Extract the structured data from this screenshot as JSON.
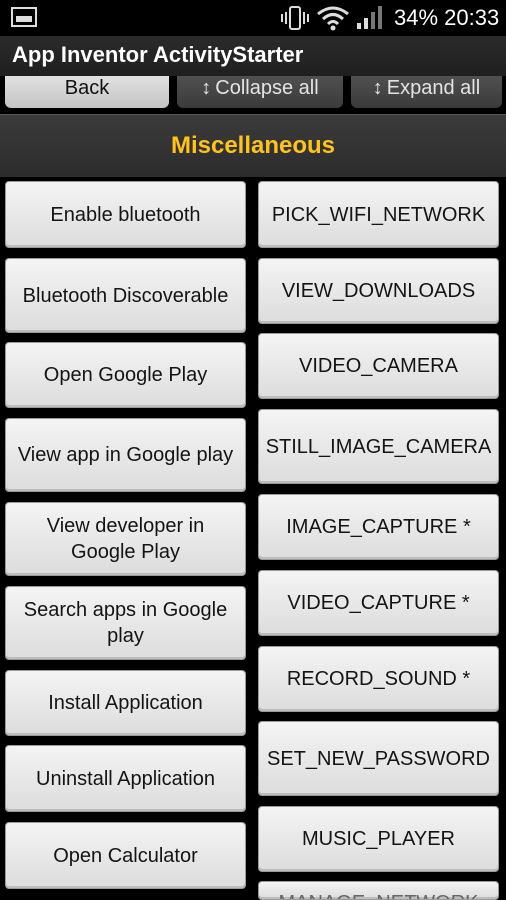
{
  "status_bar": {
    "battery": "34%",
    "time": "20:33",
    "icons": [
      "image-notification-icon",
      "vibrate-icon",
      "wifi-icon",
      "signal-icon"
    ]
  },
  "app": {
    "title": "App Inventor ActivityStarter"
  },
  "toolbar": {
    "back": "Back",
    "collapse": "Collapse all",
    "expand": "Expand all",
    "collapse_icon": "collapse-arrows-icon",
    "expand_icon": "expand-arrows-icon"
  },
  "section": {
    "title": "Miscellaneous"
  },
  "left_buttons": [
    "Enable bluetooth",
    "Bluetooth Discoverable",
    "Open Google Play",
    "View app in Google play",
    "View developer in Google Play",
    "Search apps in Google play",
    "Install Application",
    "Uninstall Application",
    "Open Calculator"
  ],
  "right_buttons": [
    "PICK_WIFI_NETWORK",
    "VIEW_DOWNLOADS",
    "VIDEO_CAMERA",
    "STILL_IMAGE_CAMERA",
    "IMAGE_CAPTURE *",
    "VIDEO_CAPTURE *",
    "RECORD_SOUND *",
    "SET_NEW_PASSWORD",
    "MUSIC_PLAYER",
    "MANAGE_NETWORK"
  ],
  "colors": {
    "accent": "#ffc31a",
    "button_text": "#141414"
  }
}
